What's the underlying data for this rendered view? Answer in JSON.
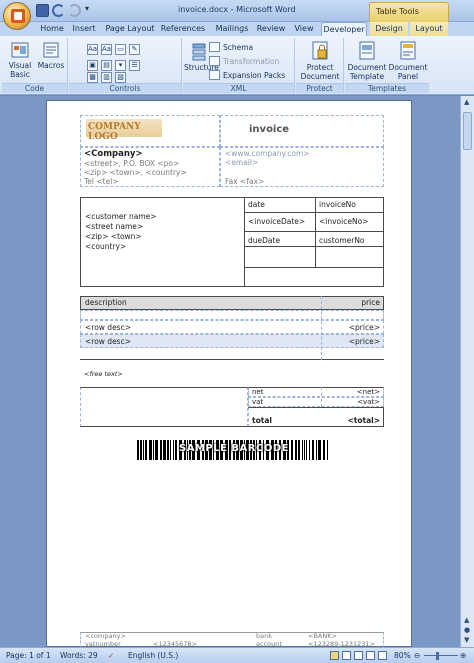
{
  "window": {
    "title": "invoice.docx - Microsoft Word",
    "contextual_tab": "Table Tools"
  },
  "tabs": [
    "Home",
    "Insert",
    "Page Layout",
    "References",
    "Mailings",
    "Review",
    "View",
    "Developer",
    "Design",
    "Layout"
  ],
  "ribbon": {
    "code": {
      "label": "Code",
      "visual_basic": "Visual Basic",
      "macros": "Macros"
    },
    "controls": {
      "label": "Controls"
    },
    "xml": {
      "label": "XML",
      "structure": "Structure",
      "schema": "Schema",
      "transformation": "Transformation",
      "expansion_packs": "Expansion Packs"
    },
    "protect": {
      "label": "Protect",
      "protect_document": "Protect Document"
    },
    "templates": {
      "label": "Templates",
      "document_template": "Document Template",
      "document_panel": "Document Panel"
    }
  },
  "invoice": {
    "logo": "COMPANY LOGO",
    "heading": "invoice",
    "company": "<Company>",
    "street": "<street>, P.O. BOX <po>",
    "zip": "<zip> <town>, <country>",
    "tel": "Tel <tel>",
    "www": "<www.company.com>",
    "email": "<email>",
    "fax": "Fax <fax>",
    "customer_name": "<customer name>",
    "customer_street": "<street name>",
    "customer_zip": "<zip> <town>",
    "customer_country": "<country>",
    "date_label": "date",
    "invoiceno_label": "invoiceNo",
    "invoice_date": "<invoiceDate>",
    "invoice_no": "<invoiceNo>",
    "duedate_label": "dueDate",
    "customerno_label": "customerNo",
    "description_label": "description",
    "price_label": "price",
    "rows": [
      {
        "desc": "<row desc>",
        "price": "<price>"
      },
      {
        "desc": "<row desc>",
        "price": "<price>"
      }
    ],
    "free_text": "<free text>",
    "net_label": "net",
    "net_value": "<net>",
    "vat_label": "vat",
    "vat_value": "<vat>",
    "total_label": "total",
    "total_value": "<total>",
    "barcode_text": "SAMPLE BARCODE",
    "footer": {
      "company": "<company>",
      "vatnumber_label": "vatnumber",
      "vatnumber": "<12345678>",
      "bank_label": "bank",
      "bank": "<BANK>",
      "account_label": "account",
      "account": "<123289-1231231>"
    }
  },
  "status": {
    "page": "Page: 1 of 1",
    "words": "Words: 29",
    "language": "English (U.S.)",
    "zoom": "80%"
  }
}
